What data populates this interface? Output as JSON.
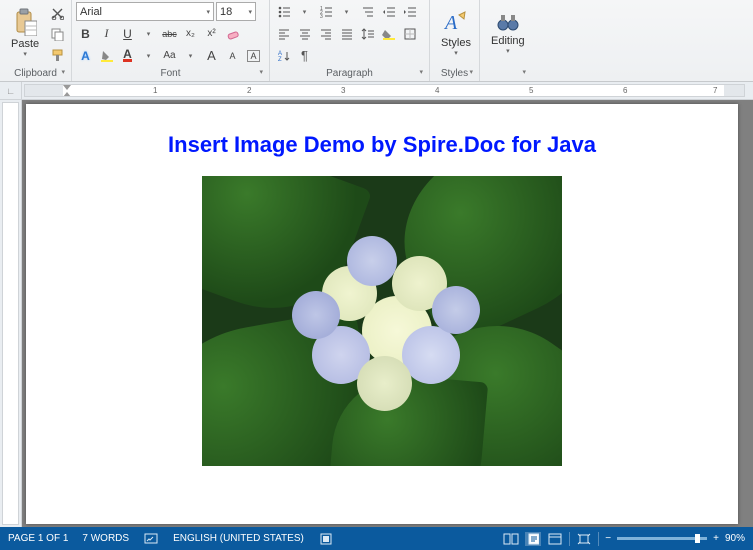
{
  "ribbon": {
    "clipboard": {
      "label": "Clipboard",
      "paste": "Paste"
    },
    "font": {
      "label": "Font",
      "family": "Arial",
      "size": "18",
      "bold": "B",
      "italic": "I",
      "underline": "U",
      "strike": "abc",
      "sub": "x₂",
      "sup": "x²",
      "caseA": "A",
      "case_aa": "Aa",
      "grow": "A",
      "shrink": "A"
    },
    "paragraph": {
      "label": "Paragraph"
    },
    "styles": {
      "label": "Styles",
      "btn": "Styles"
    },
    "editing": {
      "label": "",
      "btn": "Editing"
    }
  },
  "ruler": {
    "marks": [
      "1",
      "2",
      "3",
      "4",
      "5",
      "6",
      "7"
    ]
  },
  "document": {
    "title": "Insert Image Demo by Spire.Doc for Java"
  },
  "statusbar": {
    "page": "PAGE 1 OF 1",
    "words": "7 WORDS",
    "lang": "ENGLISH (UNITED STATES)",
    "zoom": "90%",
    "minus": "−",
    "plus": "+"
  }
}
